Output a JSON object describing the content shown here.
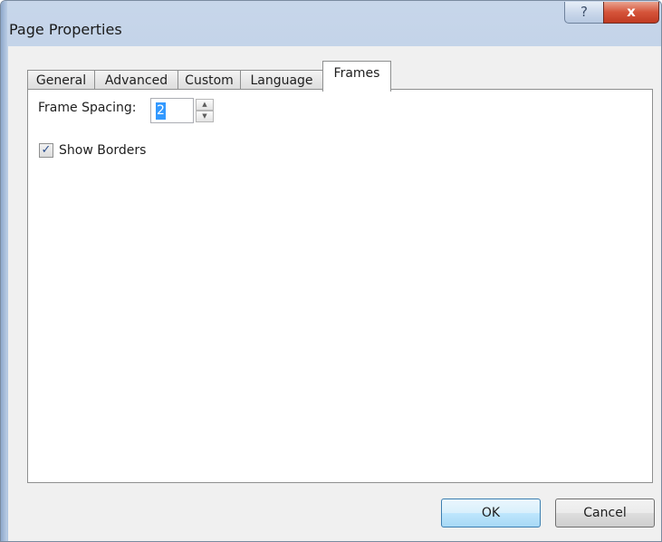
{
  "window": {
    "title": "Page Properties"
  },
  "titlebar_buttons": {
    "help": "?",
    "close": "x"
  },
  "tabs": [
    {
      "label": "General",
      "active": false
    },
    {
      "label": "Advanced",
      "active": false
    },
    {
      "label": "Custom",
      "active": false
    },
    {
      "label": "Language",
      "active": false
    },
    {
      "label": "Frames",
      "active": true
    }
  ],
  "frames": {
    "frame_spacing_label": "Frame Spacing:",
    "frame_spacing_value": "2",
    "show_borders_label": "Show Borders",
    "show_borders_checked": true
  },
  "buttons": {
    "ok": "OK",
    "cancel": "Cancel"
  },
  "colors": {
    "selection": "#3399ff",
    "title_gradient": "#b9cce4",
    "close": "#c03a22"
  }
}
